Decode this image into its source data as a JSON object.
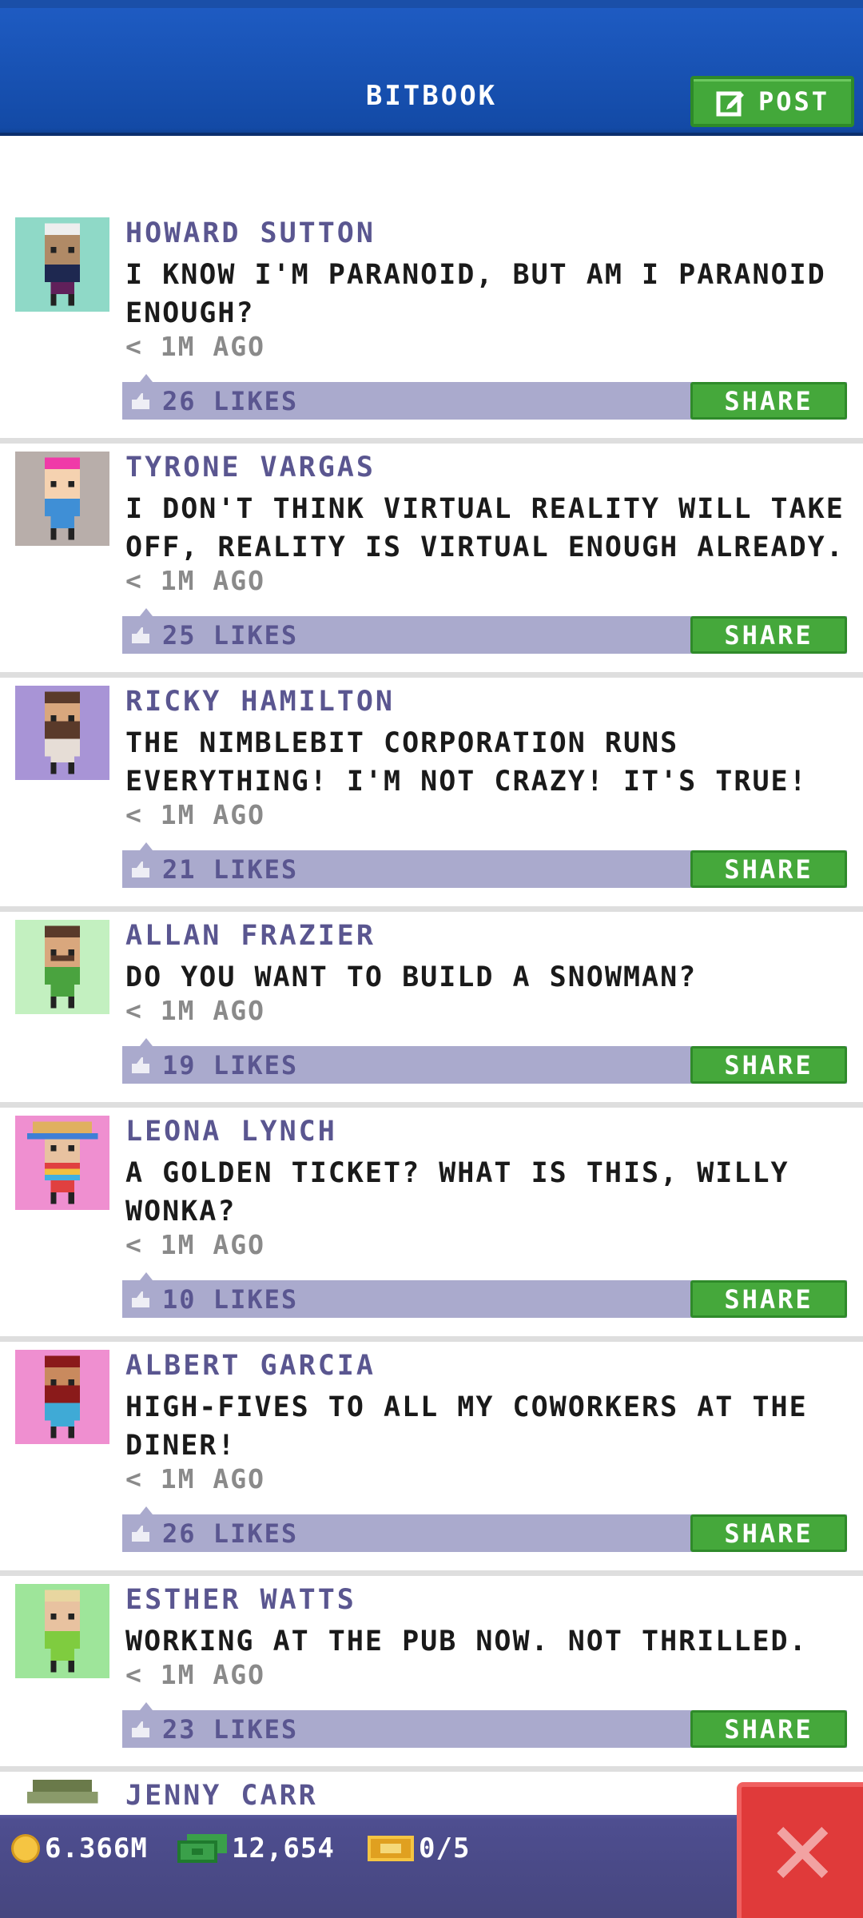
{
  "header": {
    "title": "BITBOOK",
    "post_label": "POST"
  },
  "posts": [
    {
      "name": "HOWARD SUTTON",
      "message": "I KNOW I'M PARANOID, BUT AM I PARANOID ENOUGH?",
      "time": "< 1M AGO",
      "likes": "26 LIKES",
      "share": "SHARE"
    },
    {
      "name": "TYRONE VARGAS",
      "message": "I DON'T THINK VIRTUAL REALITY WILL TAKE OFF, REALITY IS VIRTUAL ENOUGH ALREADY.",
      "time": "< 1M AGO",
      "likes": "25 LIKES",
      "share": "SHARE"
    },
    {
      "name": "RICKY HAMILTON",
      "message": "THE NIMBLEBIT CORPORATION RUNS EVERYTHING! I'M NOT CRAZY! IT'S TRUE!",
      "time": "< 1M AGO",
      "likes": "21 LIKES",
      "share": "SHARE"
    },
    {
      "name": "ALLAN FRAZIER",
      "message": "DO YOU WANT TO BUILD A SNOWMAN?",
      "time": "< 1M AGO",
      "likes": "19 LIKES",
      "share": "SHARE"
    },
    {
      "name": "LEONA LYNCH",
      "message": "A GOLDEN TICKET? WHAT IS THIS, WILLY WONKA?",
      "time": "< 1M AGO",
      "likes": "10 LIKES",
      "share": "SHARE"
    },
    {
      "name": "ALBERT GARCIA",
      "message": "HIGH-FIVES TO ALL MY COWORKERS AT THE DINER!",
      "time": "< 1M AGO",
      "likes": "26 LIKES",
      "share": "SHARE"
    },
    {
      "name": "ESTHER WATTS",
      "message": "WORKING AT THE PUB NOW. NOT THRILLED.",
      "time": "< 1M AGO",
      "likes": "23 LIKES",
      "share": "SHARE"
    },
    {
      "name": "JENNY CARR"
    }
  ],
  "status_bar": {
    "coins": "6.366M",
    "bux": "12,654",
    "tickets": "0/5"
  },
  "colors": {
    "header_blue": "#1e5bc2",
    "accent_green": "#45a83b",
    "likes_bar": "#aaaacd",
    "name_purple": "#5a5690",
    "close_red": "#e03a3a"
  }
}
